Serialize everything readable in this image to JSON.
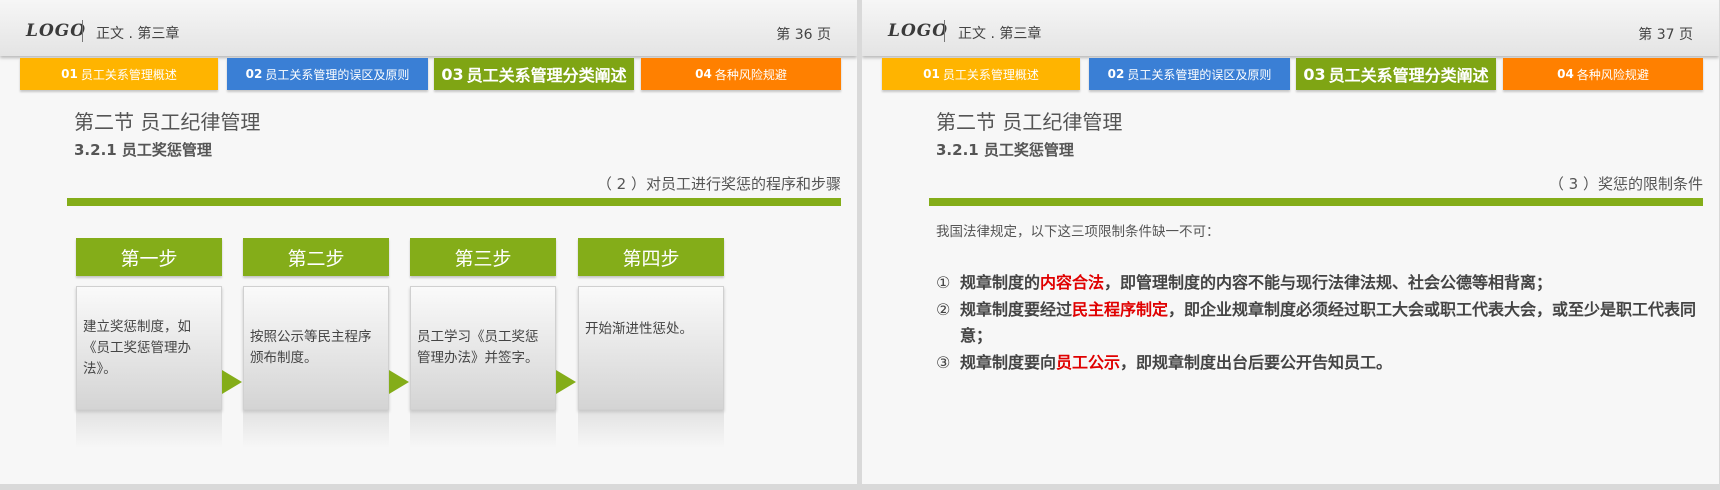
{
  "slides": [
    {
      "logo": "LOGO",
      "chapter": "正文 . 第三章",
      "page": "第 36 页",
      "tabs": [
        {
          "num": "01",
          "label": "员工关系管理概述"
        },
        {
          "num": "02",
          "label": "员工关系管理的误区及原则"
        },
        {
          "num": "03",
          "label": "员工关系管理分类阐述"
        },
        {
          "num": "04",
          "label": "各种风险规避"
        }
      ],
      "section_title": "第二节  员工纪律管理",
      "sub_title": "3.2.1 员工奖惩管理",
      "topic": "（ 2 ）对员工进行奖惩的程序和步骤",
      "steps": [
        {
          "title": "第一步",
          "text": "建立奖惩制度，如《员工奖惩管理办法》。"
        },
        {
          "title": "第二步",
          "text": "按照公示等民主程序颁布制度。"
        },
        {
          "title": "第三步",
          "text": "员工学习《员工奖惩管理办法》并签字。"
        },
        {
          "title": "第四步",
          "text": "开始渐进性惩处。"
        }
      ]
    },
    {
      "logo": "LOGO",
      "chapter": "正文 . 第三章",
      "page": "第 37 页",
      "tabs": [
        {
          "num": "01",
          "label": "员工关系管理概述"
        },
        {
          "num": "02",
          "label": "员工关系管理的误区及原则"
        },
        {
          "num": "03",
          "label": "员工关系管理分类阐述"
        },
        {
          "num": "04",
          "label": "各种风险规避"
        }
      ],
      "section_title": "第二节  员工纪律管理",
      "sub_title": "3.2.1 员工奖惩管理",
      "topic": "（ 3 ）奖惩的限制条件",
      "intro": "我国法律规定，以下这三项限制条件缺一不可：",
      "rules": [
        {
          "num": "①",
          "pre": "规章制度的",
          "highlight": "内容合法",
          "post": "，即管理制度的内容不能与现行法律法规、社会公德等相背离；"
        },
        {
          "num": "②",
          "pre": "规章制度要经过",
          "highlight": "民主程序制定",
          "post": "，即企业规章制度必须经过职工大会或职工代表大会，或至少是职工代表同意；"
        },
        {
          "num": "③",
          "pre": "规章制度要向",
          "highlight": "员工公示",
          "post": "，即规章制度出台后要公开告知员工。"
        }
      ]
    }
  ],
  "colors": {
    "tab1": "#ffb400",
    "tab2": "#3a7fd5",
    "tab3": "#7fa514",
    "tab4": "#ff8000",
    "accent_green": "#84ad19",
    "highlight_red": "#e00000"
  }
}
